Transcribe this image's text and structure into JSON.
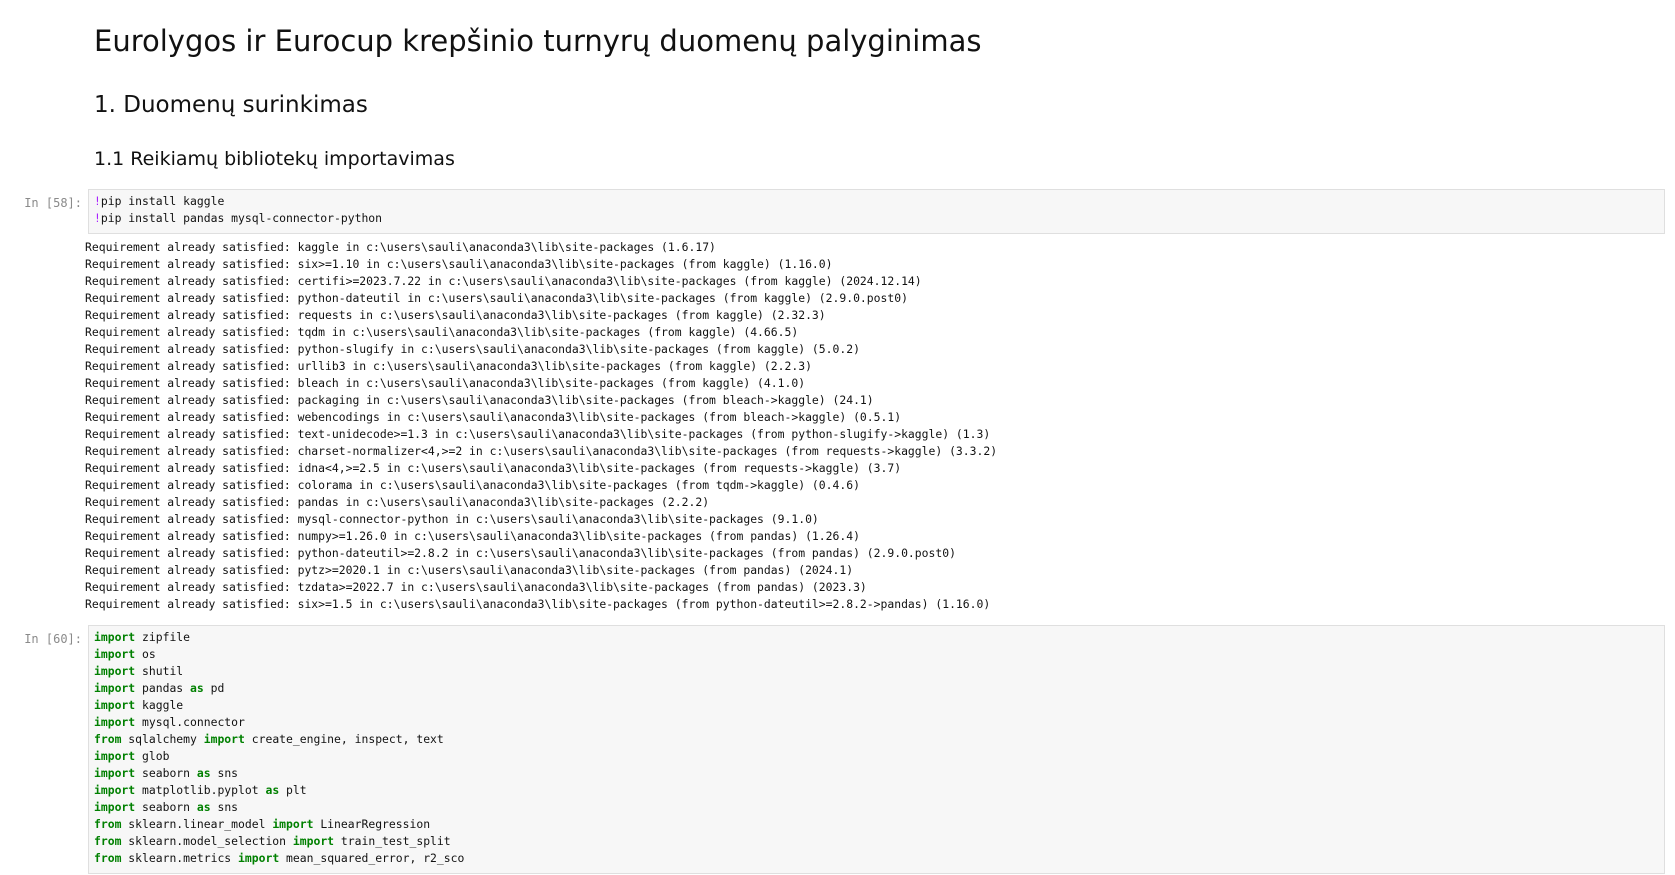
{
  "notebook": {
    "title": "Eurolygos ir Eurocup krepšinio turnyrų duomenų palyginimas",
    "section_1": "1. Duomenų surinkimas",
    "section_1_1": "1.1 Reikiamų bibliotekų importavimas"
  },
  "cell_58": {
    "prompt": "In [58]:",
    "lines": [
      {
        "bang": "!",
        "text": "pip install kaggle"
      },
      {
        "bang": "!",
        "text": "pip install pandas mysql-connector-python"
      }
    ],
    "output": [
      "Requirement already satisfied: kaggle in c:\\users\\sauli\\anaconda3\\lib\\site-packages (1.6.17)",
      "Requirement already satisfied: six>=1.10 in c:\\users\\sauli\\anaconda3\\lib\\site-packages (from kaggle) (1.16.0)",
      "Requirement already satisfied: certifi>=2023.7.22 in c:\\users\\sauli\\anaconda3\\lib\\site-packages (from kaggle) (2024.12.14)",
      "Requirement already satisfied: python-dateutil in c:\\users\\sauli\\anaconda3\\lib\\site-packages (from kaggle) (2.9.0.post0)",
      "Requirement already satisfied: requests in c:\\users\\sauli\\anaconda3\\lib\\site-packages (from kaggle) (2.32.3)",
      "Requirement already satisfied: tqdm in c:\\users\\sauli\\anaconda3\\lib\\site-packages (from kaggle) (4.66.5)",
      "Requirement already satisfied: python-slugify in c:\\users\\sauli\\anaconda3\\lib\\site-packages (from kaggle) (5.0.2)",
      "Requirement already satisfied: urllib3 in c:\\users\\sauli\\anaconda3\\lib\\site-packages (from kaggle) (2.2.3)",
      "Requirement already satisfied: bleach in c:\\users\\sauli\\anaconda3\\lib\\site-packages (from kaggle) (4.1.0)",
      "Requirement already satisfied: packaging in c:\\users\\sauli\\anaconda3\\lib\\site-packages (from bleach->kaggle) (24.1)",
      "Requirement already satisfied: webencodings in c:\\users\\sauli\\anaconda3\\lib\\site-packages (from bleach->kaggle) (0.5.1)",
      "Requirement already satisfied: text-unidecode>=1.3 in c:\\users\\sauli\\anaconda3\\lib\\site-packages (from python-slugify->kaggle) (1.3)",
      "Requirement already satisfied: charset-normalizer<4,>=2 in c:\\users\\sauli\\anaconda3\\lib\\site-packages (from requests->kaggle) (3.3.2)",
      "Requirement already satisfied: idna<4,>=2.5 in c:\\users\\sauli\\anaconda3\\lib\\site-packages (from requests->kaggle) (3.7)",
      "Requirement already satisfied: colorama in c:\\users\\sauli\\anaconda3\\lib\\site-packages (from tqdm->kaggle) (0.4.6)",
      "Requirement already satisfied: pandas in c:\\users\\sauli\\anaconda3\\lib\\site-packages (2.2.2)",
      "Requirement already satisfied: mysql-connector-python in c:\\users\\sauli\\anaconda3\\lib\\site-packages (9.1.0)",
      "Requirement already satisfied: numpy>=1.26.0 in c:\\users\\sauli\\anaconda3\\lib\\site-packages (from pandas) (1.26.4)",
      "Requirement already satisfied: python-dateutil>=2.8.2 in c:\\users\\sauli\\anaconda3\\lib\\site-packages (from pandas) (2.9.0.post0)",
      "Requirement already satisfied: pytz>=2020.1 in c:\\users\\sauli\\anaconda3\\lib\\site-packages (from pandas) (2024.1)",
      "Requirement already satisfied: tzdata>=2022.7 in c:\\users\\sauli\\anaconda3\\lib\\site-packages (from pandas) (2023.3)",
      "Requirement already satisfied: six>=1.5 in c:\\users\\sauli\\anaconda3\\lib\\site-packages (from python-dateutil>=2.8.2->pandas) (1.16.0)"
    ]
  },
  "cell_60": {
    "prompt": "In [60]:",
    "lines": [
      [
        {
          "k": "import"
        },
        {
          "t": " zipfile"
        }
      ],
      [
        {
          "k": "import"
        },
        {
          "t": " os"
        }
      ],
      [
        {
          "k": "import"
        },
        {
          "t": " shutil"
        }
      ],
      [
        {
          "k": "import"
        },
        {
          "t": " pandas "
        },
        {
          "k": "as"
        },
        {
          "t": " pd"
        }
      ],
      [
        {
          "k": "import"
        },
        {
          "t": " kaggle"
        }
      ],
      [
        {
          "k": "import"
        },
        {
          "t": " mysql.connector"
        }
      ],
      [
        {
          "k": "from"
        },
        {
          "t": " sqlalchemy "
        },
        {
          "k": "import"
        },
        {
          "t": " create_engine, inspect, text"
        }
      ],
      [
        {
          "k": "import"
        },
        {
          "t": " glob"
        }
      ],
      [
        {
          "k": "import"
        },
        {
          "t": " seaborn "
        },
        {
          "k": "as"
        },
        {
          "t": " sns"
        }
      ],
      [
        {
          "k": "import"
        },
        {
          "t": " matplotlib.pyplot "
        },
        {
          "k": "as"
        },
        {
          "t": " plt"
        }
      ],
      [
        {
          "k": "import"
        },
        {
          "t": " seaborn "
        },
        {
          "k": "as"
        },
        {
          "t": " sns"
        }
      ],
      [
        {
          "k": "from"
        },
        {
          "t": " sklearn.linear_model "
        },
        {
          "k": "import"
        },
        {
          "t": " LinearRegression"
        }
      ],
      [
        {
          "k": "from"
        },
        {
          "t": " sklearn.model_selection "
        },
        {
          "k": "import"
        },
        {
          "t": " train_test_split"
        }
      ],
      [
        {
          "k": "from"
        },
        {
          "t": " sklearn.metrics "
        },
        {
          "k": "import"
        },
        {
          "t": " mean_squared_error, r2_sco"
        }
      ]
    ]
  }
}
